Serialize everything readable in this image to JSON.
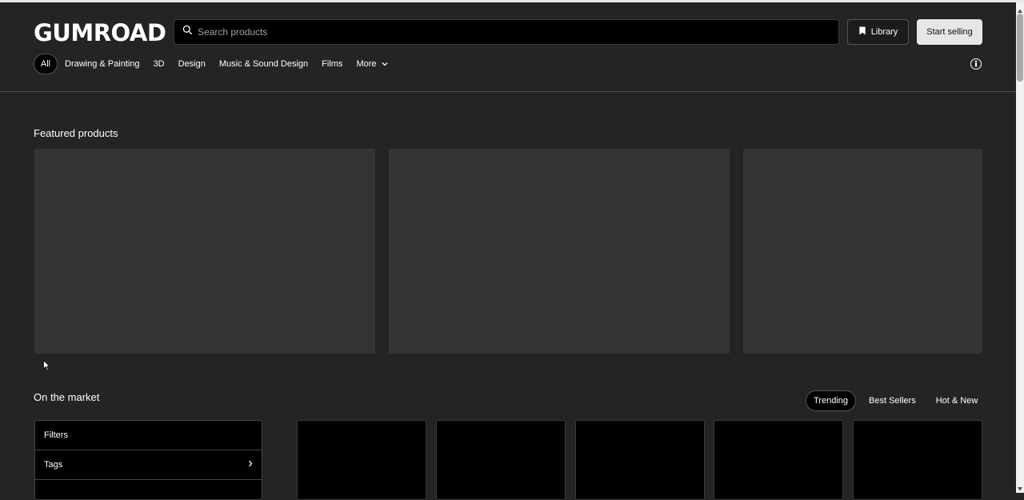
{
  "header": {
    "logo": "GUMROAD",
    "search": {
      "placeholder": "Search products",
      "value": ""
    },
    "library_label": "Library",
    "start_selling_label": "Start selling"
  },
  "nav": {
    "items": [
      {
        "label": "All"
      },
      {
        "label": "Drawing & Painting"
      },
      {
        "label": "3D"
      },
      {
        "label": "Design"
      },
      {
        "label": "Music & Sound Design"
      },
      {
        "label": "Films"
      },
      {
        "label": "More"
      }
    ]
  },
  "featured": {
    "title": "Featured products"
  },
  "market": {
    "title": "On the market",
    "sort_tabs": [
      {
        "label": "Trending"
      },
      {
        "label": "Best Sellers"
      },
      {
        "label": "Hot & New"
      }
    ],
    "filters": {
      "title": "Filters",
      "tags_label": "Tags"
    }
  },
  "colors": {
    "background": "#242424",
    "card_placeholder": "#343434",
    "accent_light": "#e6e6e6"
  }
}
